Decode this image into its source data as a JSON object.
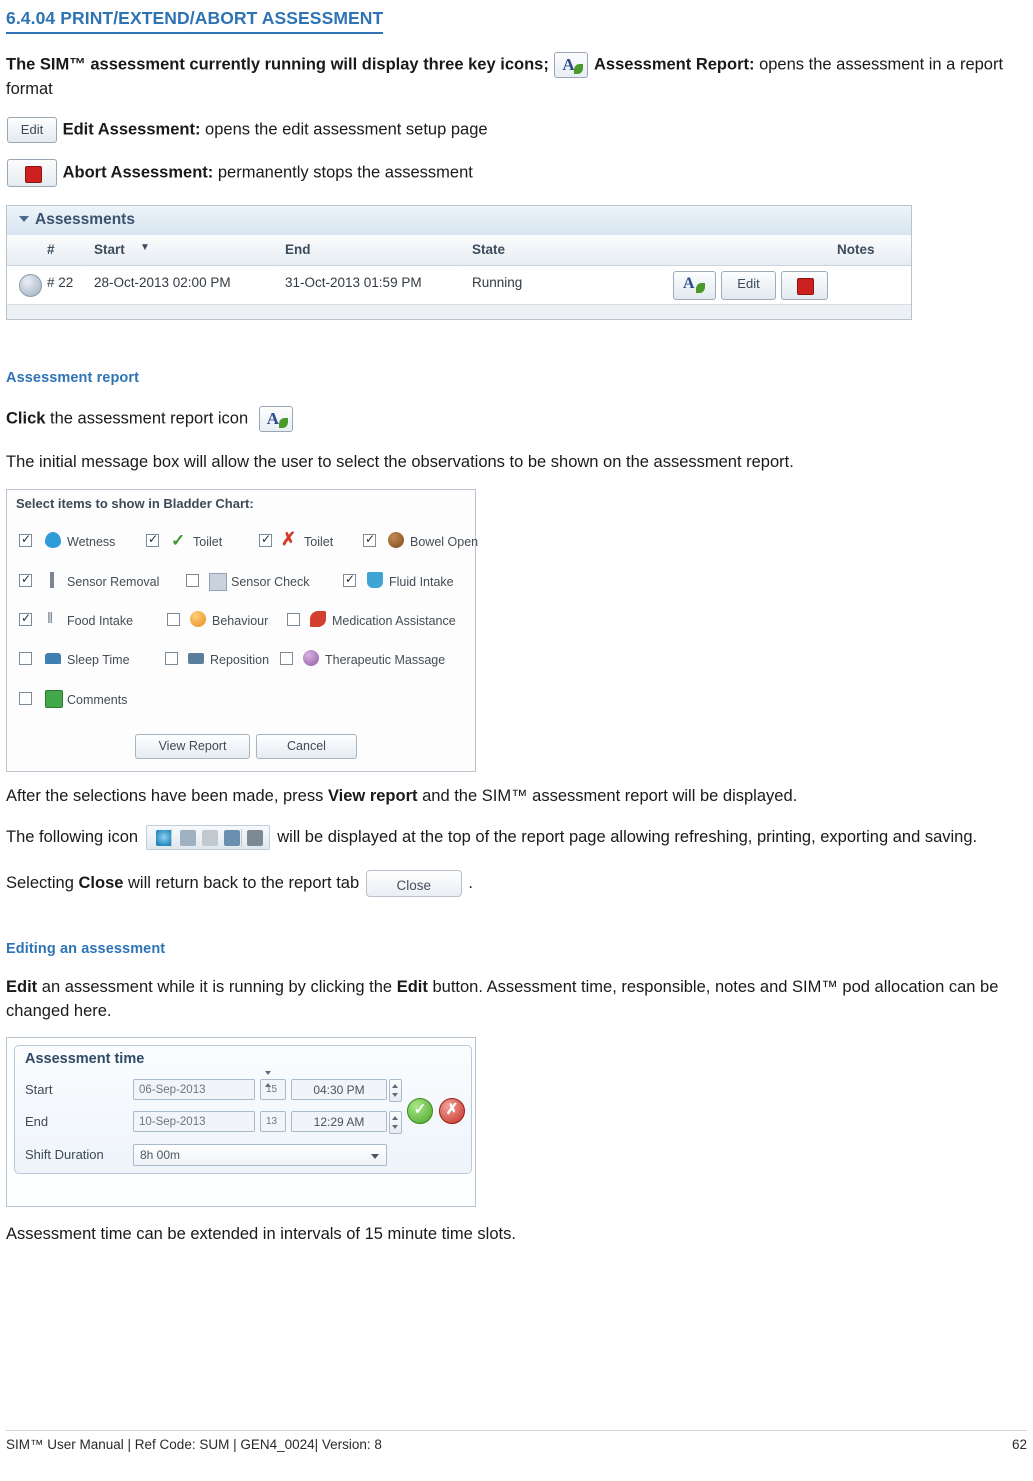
{
  "heading": "6.4.04 PRINT/EXTEND/ABORT ASSESSMENT",
  "intro": {
    "line1_a": "The SIM™ assessment currently running will display three key icons;",
    "line1_b": "Assessment Report:",
    "line1_c": "opens the assessment in a report format",
    "line2_b": "Edit Assessment:",
    "line2_c": "opens the edit assessment setup page",
    "line3_b": "Abort Assessment:",
    "line3_c": "permanently stops the assessment"
  },
  "assessments_figure": {
    "panel_title": "Assessments",
    "columns": [
      "#",
      "Start",
      "End",
      "State",
      "",
      "",
      "Notes"
    ],
    "sort_indicator": "▼",
    "row": {
      "number": "# 22",
      "start": "28-Oct-2013 02:00 PM",
      "end": "31-Oct-2013 01:59 PM",
      "state": "Running",
      "notes": ""
    },
    "row_buttons": {
      "report": "A",
      "edit": "Edit",
      "abort": ""
    }
  },
  "assessment_report": {
    "sub_heading": "Assessment report",
    "click_line_a": "Click",
    "click_line_b": "the assessment report icon",
    "initial_message": "The initial message box will allow the user to select the observations to be shown on the assessment report.",
    "after_line_a": "After the selections have been made, press",
    "after_line_b": "View report",
    "after_line_c": "and the SIM™ assessment report will be displayed.",
    "following_icon_a": "The following icon",
    "following_icon_b": "will be displayed at the top of the report page allowing refreshing, printing, exporting and saving.",
    "selecting_a": "Selecting",
    "selecting_b": "Close",
    "selecting_c": "will return back to the report tab",
    "selecting_d": ".",
    "close_button_label": "Close"
  },
  "select_figure": {
    "title": "Select items to show in Bladder Chart:",
    "items": [
      {
        "label": "Wetness",
        "checked": true,
        "icon": "water-drop-icon"
      },
      {
        "label": "Toilet",
        "checked": true,
        "icon": "green-check-icon"
      },
      {
        "label": "Toilet",
        "checked": true,
        "icon": "red-cross-icon"
      },
      {
        "label": "Bowel Open",
        "checked": true,
        "icon": "brown-circle-icon"
      },
      {
        "label": "Sensor Removal",
        "checked": true,
        "icon": "sensor-bar-icon"
      },
      {
        "label": "Sensor Check",
        "checked": false,
        "icon": "sensor-check-icon"
      },
      {
        "label": "Fluid Intake",
        "checked": true,
        "icon": "cup-icon"
      },
      {
        "label": "Food Intake",
        "checked": true,
        "icon": "cutlery-icon"
      },
      {
        "label": "Behaviour",
        "checked": false,
        "icon": "orange-face-icon"
      },
      {
        "label": "Medication Assistance",
        "checked": false,
        "icon": "pill-icon"
      },
      {
        "label": "Sleep Time",
        "checked": false,
        "icon": "bed-icon"
      },
      {
        "label": "Reposition",
        "checked": false,
        "icon": "reposition-icon"
      },
      {
        "label": "Therapeutic Massage",
        "checked": false,
        "icon": "hand-massage-icon"
      },
      {
        "label": "Comments",
        "checked": false,
        "icon": "comment-icon"
      }
    ],
    "buttons": {
      "view_report": "View Report",
      "cancel": "Cancel"
    }
  },
  "editing": {
    "sub_heading": "Editing an assessment",
    "line_a": "Edit",
    "line_b": "an assessment while it is running by clicking the",
    "line_c": "Edit",
    "line_d": "button. Assessment time, responsible, notes and SIM™ pod allocation can be changed here.",
    "closing_line": "Assessment time can be extended in intervals of 15 minute time slots."
  },
  "time_figure": {
    "panel_title": "Assessment time",
    "rows": [
      {
        "label": "Start",
        "date": "06-Sep-2013",
        "spin_value": "15",
        "time": "04:30 PM"
      },
      {
        "label": "End",
        "date": "10-Sep-2013",
        "spin_value": "13",
        "time": "12:29 AM"
      }
    ],
    "shift_label": "Shift Duration",
    "shift_value": "8h 00m",
    "confirm_icon": "green-tick-icon",
    "cancel_icon": "red-cross-icon"
  },
  "footer": {
    "left": "SIM™ User Manual | Ref Code: SUM | GEN4_0024| Version: 8",
    "right": "62"
  },
  "colors": {
    "accent": "#2e74b5",
    "text": "#1a1a1a",
    "abort_red": "#cf2020",
    "leaf_green": "#4a9a2a"
  }
}
